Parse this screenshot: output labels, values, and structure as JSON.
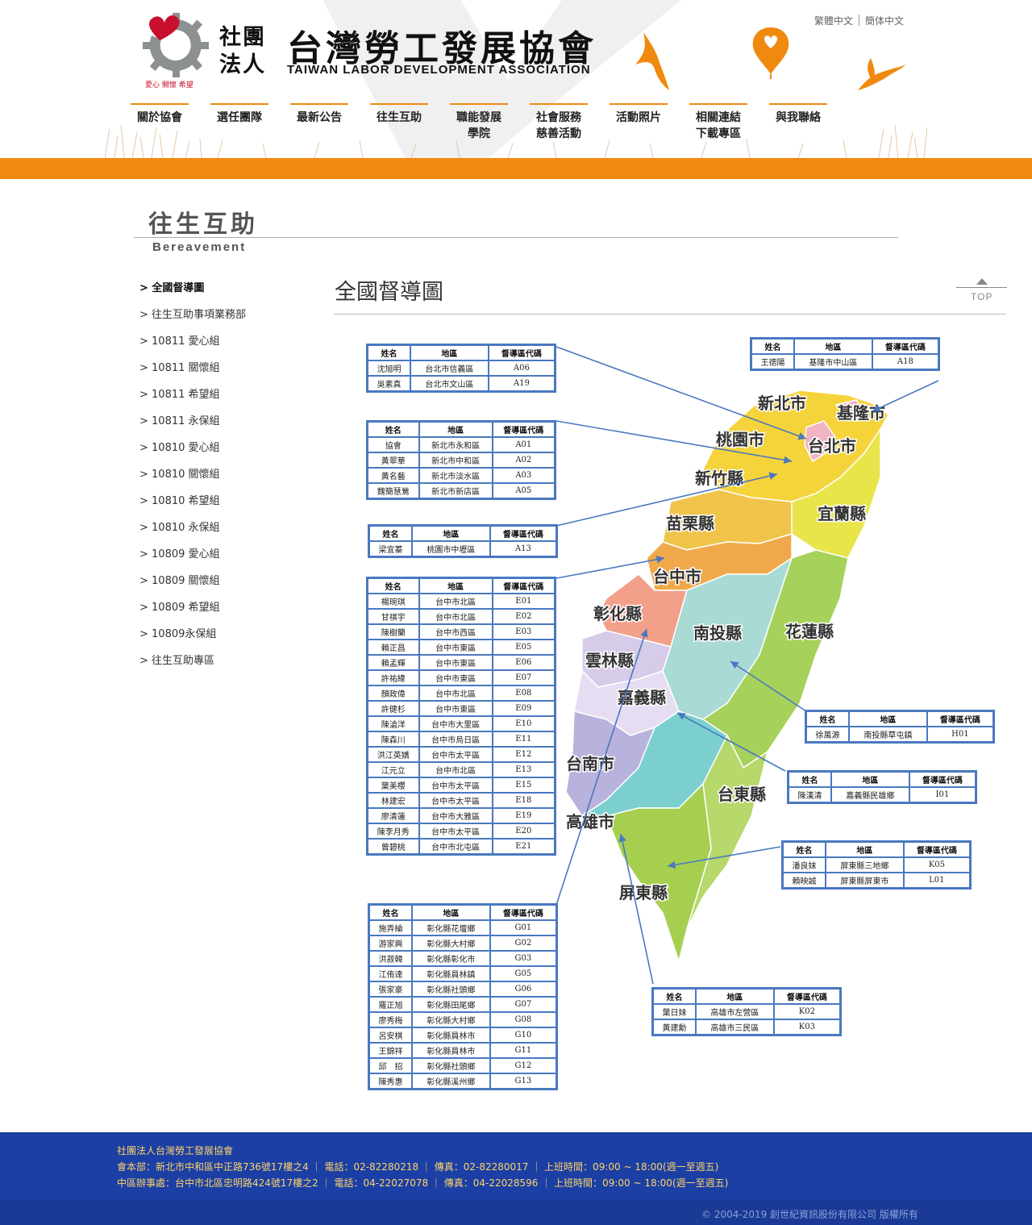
{
  "lang": {
    "trad": "繁體中文",
    "simp": "簡体中文"
  },
  "logo": {
    "corp": "社團法人",
    "name": "台灣勞工發展協會",
    "name_en": "TAIWAN LABOR DEVELOPMENT ASSOCIATION",
    "slogan": "愛心 關懷 希望"
  },
  "nav": [
    {
      "label": "關於協會"
    },
    {
      "label": "選任團隊"
    },
    {
      "label": "最新公告"
    },
    {
      "label": "往生互助"
    },
    {
      "label": "職能發展\n學院"
    },
    {
      "label": "社會服務\n慈善活動"
    },
    {
      "label": "活動照片"
    },
    {
      "label": "相關連結\n下載專區"
    },
    {
      "label": "與我聯絡"
    }
  ],
  "page": {
    "title": "往生互助",
    "subtitle": "Bereavement"
  },
  "sidebar": [
    "全國督導圖",
    "往生互助事項業務部",
    "10811 愛心組",
    "10811 關懷組",
    "10811 希望組",
    "10811 永保組",
    "10810 愛心組",
    "10810 關懷組",
    "10810 希望組",
    "10810 永保組",
    "10809 愛心組",
    "10809 關懷組",
    "10809 希望組",
    "10809永保組",
    "往生互助專區"
  ],
  "content": {
    "title": "全國督導圖",
    "top_label": "TOP"
  },
  "map": {
    "regions": [
      "新北市",
      "基隆市",
      "桃園市",
      "台北市",
      "新竹縣",
      "宜蘭縣",
      "苗栗縣",
      "台中市",
      "彰化縣",
      "南投縣",
      "花蓮縣",
      "雲林縣",
      "嘉義縣",
      "台南市",
      "台東縣",
      "高雄市",
      "屏東縣"
    ],
    "colors": {
      "north": "#f5d33a",
      "yellow2": "#e8e54a",
      "orange": "#f0a94a",
      "salmon": "#f3a08a",
      "teal": "#a9dad4",
      "green": "#a6d15a",
      "lilac": "#d6cbe8",
      "violet": "#b8b3dc",
      "cyan": "#7ccfcf",
      "olive": "#b7d86a",
      "pink": "#f2b3c4"
    }
  },
  "tables": {
    "headers": [
      "姓名",
      "地區",
      "督導區代碼"
    ],
    "t1": [
      [
        "沈旭明",
        "台北市信義區",
        "A06"
      ],
      [
        "吳素真",
        "台北市文山區",
        "A19"
      ]
    ],
    "t2": [
      [
        "王德陽",
        "基隆市中山區",
        "A18"
      ]
    ],
    "t3": [
      [
        "協會",
        "新北市永和區",
        "A01"
      ],
      [
        "黃翠華",
        "新北市中和區",
        "A02"
      ],
      [
        "黃名藝",
        "新北市淡水區",
        "A03"
      ],
      [
        "魏簡慧鶯",
        "新北市新店區",
        "A05"
      ]
    ],
    "t4": [
      [
        "梁宜蓁",
        "桃園市中壢區",
        "A13"
      ]
    ],
    "t5": [
      [
        "楊琬琪",
        "台中市北區",
        "E01"
      ],
      [
        "甘祺宇",
        "台中市北區",
        "E02"
      ],
      [
        "陳樹蘭",
        "台中市西區",
        "E03"
      ],
      [
        "賴正昌",
        "台中市東區",
        "E05"
      ],
      [
        "賴孟輝",
        "台中市東區",
        "E06"
      ],
      [
        "許祐緯",
        "台中市東區",
        "E07"
      ],
      [
        "顏政偉",
        "台中市北區",
        "E08"
      ],
      [
        "許健杉",
        "台中市東區",
        "E09"
      ],
      [
        "陳滄洋",
        "台中市大里區",
        "E10"
      ],
      [
        "陳森川",
        "台中市烏日區",
        "E11"
      ],
      [
        "洪江英嬌",
        "台中市太平區",
        "E12"
      ],
      [
        "江元立",
        "台中市北區",
        "E13"
      ],
      [
        "葉美櫻",
        "台中市太平區",
        "E15"
      ],
      [
        "林建宏",
        "台中市太平區",
        "E18"
      ],
      [
        "廖清蓮",
        "台中市大雅區",
        "E19"
      ],
      [
        "陳李月秀",
        "台中市太平區",
        "E20"
      ],
      [
        "曾碧桃",
        "台中市北屯區",
        "E21"
      ]
    ],
    "t6": [
      [
        "施弄綸",
        "彰化縣花壇鄉",
        "G01"
      ],
      [
        "游家興",
        "彰化縣大村鄉",
        "G02"
      ],
      [
        "洪菽韓",
        "彰化縣彰化市",
        "G03"
      ],
      [
        "江侑達",
        "彰化縣員林鎮",
        "G05"
      ],
      [
        "張家豪",
        "彰化縣社頭鄉",
        "G06"
      ],
      [
        "羅正旭",
        "彰化縣田尾鄉",
        "G07"
      ],
      [
        "廖秀梅",
        "彰化縣大村鄉",
        "G08"
      ],
      [
        "呂安棋",
        "彰化縣員林市",
        "G10"
      ],
      [
        "王錦祥",
        "彰化縣員林市",
        "G11"
      ],
      [
        "邱　招",
        "彰化縣社頭鄉",
        "G12"
      ],
      [
        "陳秀惠",
        "彰化縣溪州鄉",
        "G13"
      ]
    ],
    "t7": [
      [
        "徐萬源",
        "南投縣草屯鎮",
        "H01"
      ]
    ],
    "t8": [
      [
        "陳漢清",
        "嘉義縣民雄鄉",
        "I01"
      ]
    ],
    "t9": [
      [
        "潘良妹",
        "屏東縣三地鄉",
        "K05"
      ],
      [
        "賴映誠",
        "屏東縣屏東市",
        "L01"
      ]
    ],
    "t10": [
      [
        "葉日妹",
        "高雄市左營區",
        "K02"
      ],
      [
        "黃建勳",
        "高雄市三民區",
        "K03"
      ]
    ]
  },
  "footer": {
    "org": "社團法人台灣勞工發展協會",
    "hq": "會本部：新北市中和區中正路736號17樓之4 ｜ 電話：02-82280218 ｜ 傳真：02-82280017 ｜ 上班時間：09:00 ~ 18:00(週一至週五)",
    "central": "中區辦事處：台中市北區忠明路424號17樓之2 ｜ 電話：04-22027078 ｜ 傳真：04-22028596 ｜ 上班時間：09:00 ~ 18:00(週一至週五)",
    "copyright": "© 2004-2019 創世紀資訊股份有限公司 版權所有"
  },
  "theme": {
    "orange": "#f08a0f",
    "footer_blue": "#1b3fa4",
    "table_blue": "#4a78c0"
  }
}
